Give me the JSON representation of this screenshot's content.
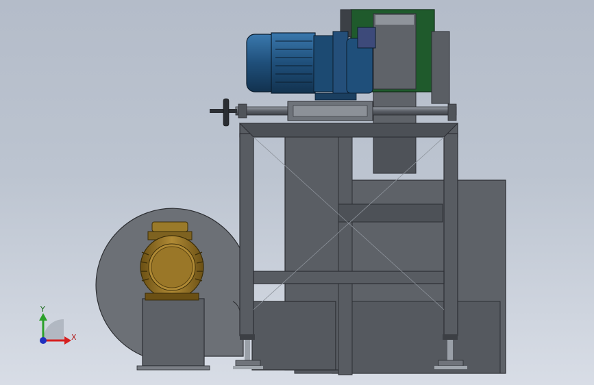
{
  "viewport": {
    "background_top": "#b4bcc9",
    "background_bottom": "#d8dde6"
  },
  "triad": {
    "y_label": "Y",
    "x_label": "X",
    "y_color": "#2aa02a",
    "x_color": "#d62020",
    "z_color": "#2030c0"
  },
  "colors": {
    "frame": "#55595f",
    "frame_dark": "#3a3d42",
    "housing": "#5a5e64",
    "motor_blue": "#1f4f7a",
    "fan_motor_gold": "#8a6a1e",
    "drive_green": "#1f5a2c",
    "fan_disc": "#6c7076"
  }
}
